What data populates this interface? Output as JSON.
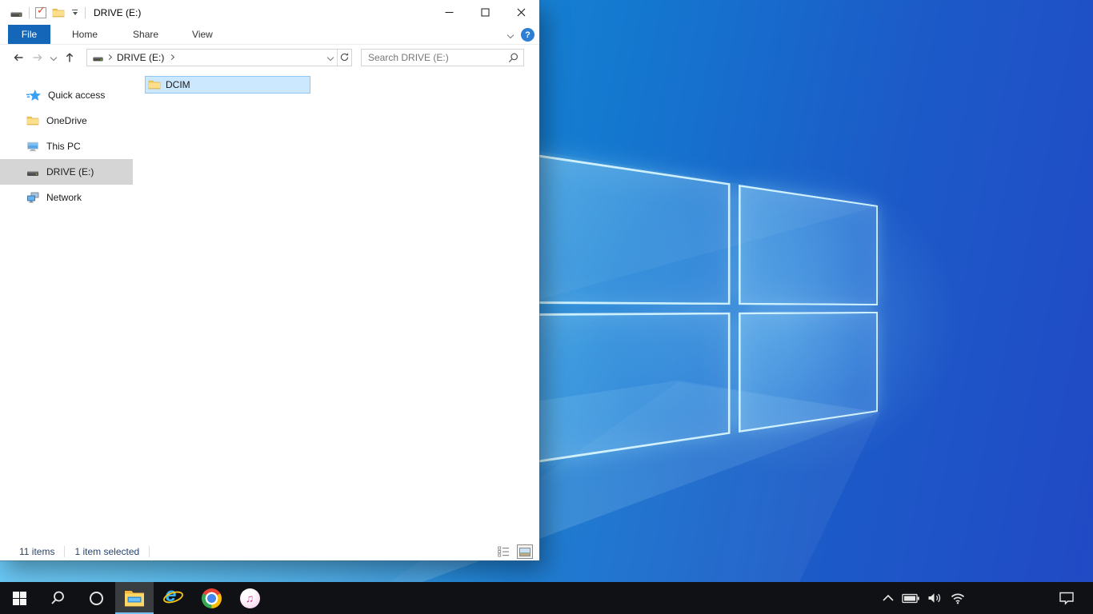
{
  "window": {
    "title": "DRIVE (E:)",
    "quick_access_icons": [
      "drive-icon",
      "properties-icon",
      "new-folder-icon",
      "customize-quick-access-icon"
    ],
    "caption_buttons": [
      "minimize",
      "maximize",
      "close"
    ]
  },
  "ribbon": {
    "file_tab": "File",
    "tabs": [
      "Home",
      "Share",
      "View"
    ],
    "help_glyph": "?"
  },
  "navigation": {
    "toolbar_icons": [
      "back-icon",
      "forward-icon",
      "recent-locations-chevron-icon",
      "up-icon"
    ],
    "breadcrumb_drive": "DRIVE (E:)",
    "address_icons": [
      "drive-icon",
      "address-dropdown-chevron-icon",
      "refresh-icon"
    ],
    "search_placeholder": "Search DRIVE (E:)"
  },
  "sidebar": {
    "items": [
      {
        "label": "Quick access",
        "icon": "quick-access-star-icon",
        "selected": false
      },
      {
        "label": "OneDrive",
        "icon": "folder-icon",
        "selected": false
      },
      {
        "label": "This PC",
        "icon": "monitor-icon",
        "selected": false
      },
      {
        "label": "DRIVE (E:)",
        "icon": "drive-icon",
        "selected": true
      },
      {
        "label": "Network",
        "icon": "network-icon",
        "selected": false
      }
    ]
  },
  "files": {
    "items": [
      {
        "name": "DCIM",
        "icon": "folder-icon",
        "selected": true
      }
    ]
  },
  "statusbar": {
    "count": "11 items",
    "selection": "1 item selected",
    "view_buttons": [
      "details-view-icon",
      "large-thumbnails-view-icon"
    ]
  },
  "taskbar": {
    "buttons": [
      "start",
      "search",
      "cortana",
      "file-explorer",
      "internet-explorer",
      "chrome",
      "itunes"
    ],
    "active_button": "file-explorer",
    "tray_icons": [
      "hidden-icons-chevron",
      "battery",
      "volume",
      "wifi",
      "action-center"
    ]
  },
  "icons": {
    "properties_check": "✓",
    "quick_access_glyph": "★",
    "itunes_glyph": "♫",
    "ie_glyph": "e"
  },
  "colors": {
    "file_tab_blue": "#1467b8",
    "selection_bg": "#cce8ff",
    "selection_border": "#8fc7f5",
    "sidebar_selected": "#d5d5d5",
    "taskbar_bg": "#101114",
    "taskbar_underline": "#76c0f0",
    "desktop_light": "#2aa7ea",
    "desktop_dark": "#2149c5",
    "status_text": "#26436b"
  }
}
